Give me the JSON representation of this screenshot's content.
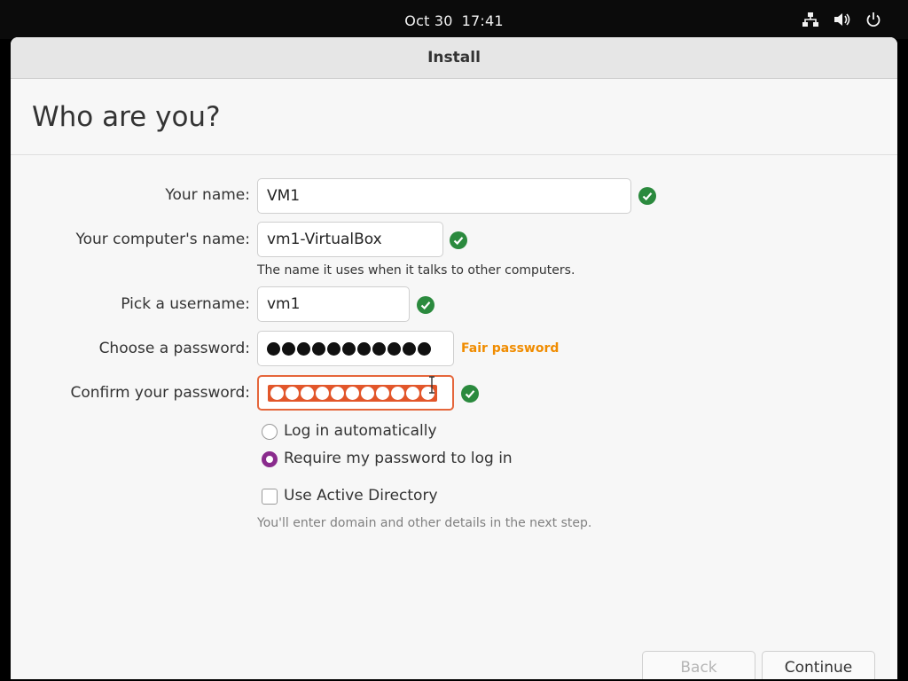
{
  "topbar": {
    "date": "Oct 30",
    "time": "17:41",
    "icons": [
      "network-icon",
      "volume-icon",
      "power-icon"
    ]
  },
  "window": {
    "title": "Install",
    "heading": "Who are you?"
  },
  "form": {
    "name": {
      "label": "Your name:",
      "value": "VM1",
      "valid": true
    },
    "computer": {
      "label": "Your computer's name:",
      "value": "vm1-VirtualBox",
      "hint": "The name it uses when it talks to other computers.",
      "valid": true
    },
    "username": {
      "label": "Pick a username:",
      "value": "vm1",
      "valid": true
    },
    "password": {
      "label": "Choose a password:",
      "strength": "Fair password",
      "strength_color": "#f08c00",
      "masked_length": 11
    },
    "confirm": {
      "label": "Confirm your password:",
      "masked_length": 11,
      "valid": true
    },
    "login_options": [
      {
        "label": "Log in automatically",
        "selected": false
      },
      {
        "label": "Require my password to log in",
        "selected": true
      }
    ],
    "active_directory": {
      "label": "Use Active Directory",
      "checked": false,
      "hint": "You'll enter domain and other details in the next step."
    }
  },
  "buttons": {
    "back": "Back",
    "continue": "Continue"
  },
  "colors": {
    "accent_radio": "#8a2b8d",
    "error_border": "#e5663b",
    "valid_check": "#2b8a3e"
  }
}
